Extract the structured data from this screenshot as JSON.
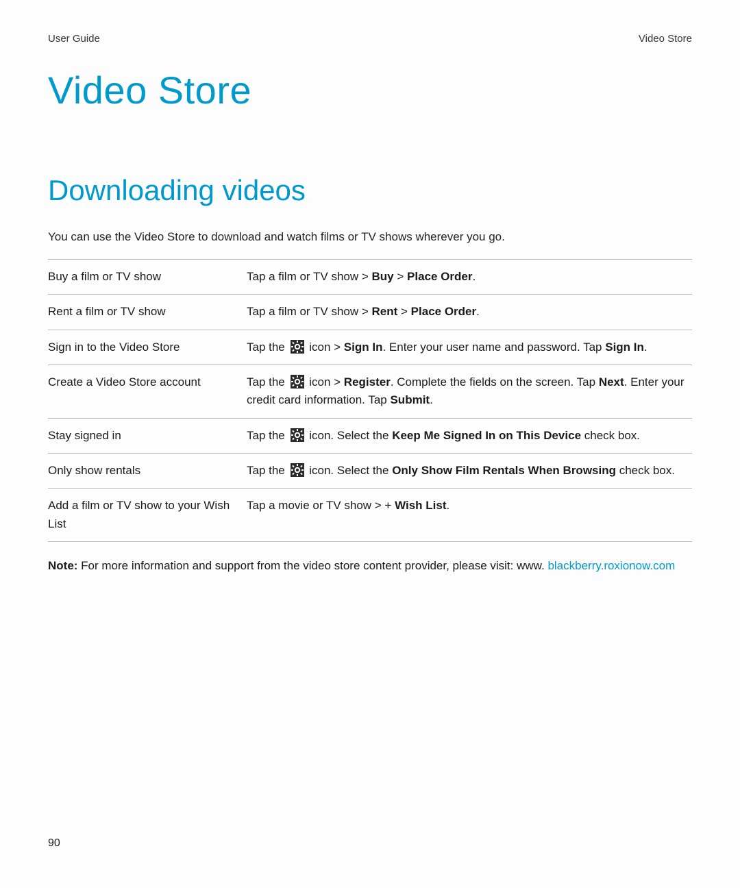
{
  "header": {
    "left": "User Guide",
    "right": "Video Store"
  },
  "title": "Video Store",
  "section": "Downloading videos",
  "intro": "You can use the Video Store to download and watch films or TV shows wherever you go.",
  "rows": {
    "r0": {
      "action": "Buy a film or TV show",
      "pre": "Tap a film or TV show > ",
      "b1": "Buy",
      "mid": " > ",
      "b2": "Place Order",
      "post": "."
    },
    "r1": {
      "action": "Rent a film or TV show",
      "pre": "Tap a film or TV show > ",
      "b1": "Rent",
      "mid": " > ",
      "b2": "Place Order",
      "post": "."
    },
    "r2": {
      "action": "Sign in to the Video Store",
      "pre": "Tap the ",
      "post_icon": " icon > ",
      "b1": "Sign In",
      "mid": ". Enter your user name and password. Tap ",
      "b2": "Sign In",
      "post": "."
    },
    "r3": {
      "action": "Create a Video Store account",
      "pre": "Tap the ",
      "post_icon": " icon > ",
      "b1": "Register",
      "mid": ". Complete the fields on the screen. Tap ",
      "b2": "Next",
      "mid2": ". Enter your credit card information. Tap ",
      "b3": "Submit",
      "post": "."
    },
    "r4": {
      "action": "Stay signed in",
      "pre": "Tap the ",
      "post_icon": " icon. Select the ",
      "b1": "Keep Me Signed In on This Device",
      "post": " check box."
    },
    "r5": {
      "action": "Only show rentals",
      "pre": "Tap the ",
      "post_icon": " icon. Select the ",
      "b1": "Only Show Film Rentals When Browsing",
      "post": " check box."
    },
    "r6": {
      "action": "Add a film or TV show to your Wish List",
      "pre": "Tap a movie or TV show > + ",
      "b1": "Wish List",
      "post": "."
    }
  },
  "note": {
    "label": "Note: ",
    "text": "For more information and support from the video store content provider, please visit: www. ",
    "link": "blackberry.roxionow.com"
  },
  "page_number": "90"
}
